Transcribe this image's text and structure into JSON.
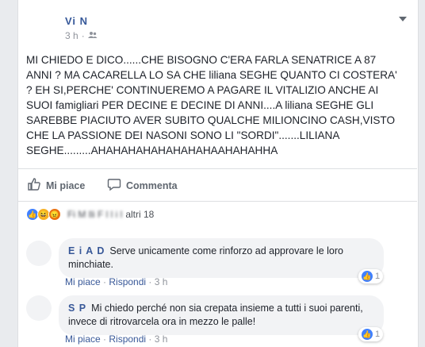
{
  "post": {
    "author": "Vi          N",
    "time": "3 h",
    "privacy_icon": "friends-icon",
    "text": "MI CHIEDO E DICO......CHE BISOGNO C'ERA FARLA SENATRICE A 87 ANNI ? MA CACARELLA LO SA CHE liliana SEGHE QUANTO CI COSTERA' ? EH SI,PERCHE' CONTINUEREMO A PAGARE IL VITALIZIO ANCHE AI SUOI famigliari PER DECINE E DECINE DI ANNI....A liliana SEGHE GLI SAREBBE PIACIUTO AVER SUBITO QUALCHE MILIONCINO CASH,VISTO CHE LA PASSIONE DEI NASONI SONO LI \"SORDI\".......LILIANA SEGHE.........AHAHAHAHAHAHAHAHAAHAHAHHA"
  },
  "actions": {
    "like": "Mi piace",
    "comment": "Commenta"
  },
  "reactions": {
    "names": "Fi   M   lli  F   l  l  i  l",
    "others": "altri 18"
  },
  "comments": [
    {
      "name": "E   i  A       D",
      "text": "Serve unicamente come rinforzo ad approvare le loro minchiate.",
      "like": "Mi piace",
      "reply": "Rispondi",
      "time": "3 h",
      "likes": "1"
    },
    {
      "name": "S         P",
      "text": "Mi chiedo perché non sia crepata insieme a tutti i suoi parenti, invece di ritrovarcela ora in mezzo le palle!",
      "like": "Mi piace",
      "reply": "Rispondi",
      "time": "3 h",
      "likes": "1"
    }
  ],
  "colors": {
    "link": "#365899",
    "like_blue": "#4080ff",
    "bubble": "#f2f3f5"
  }
}
